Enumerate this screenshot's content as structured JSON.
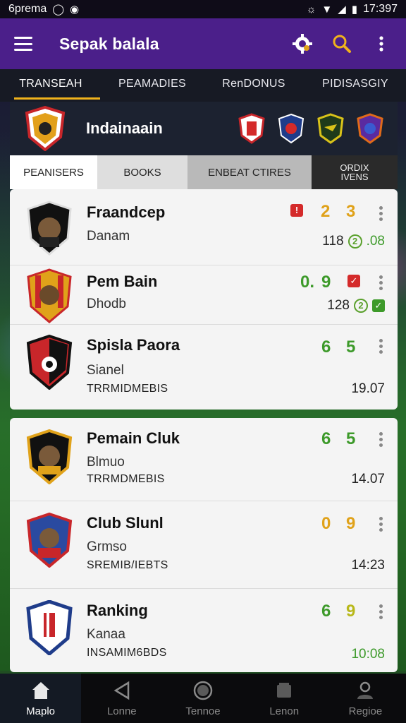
{
  "status_bar": {
    "carrier": "6prema",
    "time": "17:397"
  },
  "app_bar": {
    "title": "Sepak balala"
  },
  "tabs": [
    {
      "label": "TRANSEAH",
      "active": true
    },
    {
      "label": "PEAMADIES",
      "active": false
    },
    {
      "label": "RenDONUS",
      "active": false
    },
    {
      "label": "PIDISASGIY",
      "active": false
    }
  ],
  "league": {
    "name": "Indainaain"
  },
  "filters": [
    {
      "label": "PEANISERS"
    },
    {
      "label": "BOOKS"
    },
    {
      "label": "ENBEAT CTIRES"
    },
    {
      "label_line1": "ORDIX",
      "label_line2": "IVENS"
    }
  ],
  "cards": {
    "first": [
      {
        "name": "Fraandcep",
        "sub": "Danam",
        "sub2": "",
        "score1": "2",
        "score2": "3",
        "meta_value": "118",
        "meta_extra": ".08",
        "chip": "!"
      },
      {
        "name": "Pem Bain",
        "sub": "Dhodb",
        "sub2": "",
        "score1": "0.",
        "score2": "9",
        "meta_value": "128",
        "meta_extra": "",
        "chip": ""
      },
      {
        "name": "Spisla Paora",
        "sub": "Sianel",
        "sub2": "TRRMIDMEBIS",
        "score1": "6",
        "score2": "5",
        "meta_value": "19.07",
        "meta_extra": "",
        "chip": ""
      }
    ],
    "second": [
      {
        "name": "Pemain Cluk",
        "sub": "Blmuo",
        "sub2": "TRRMDMEBIS",
        "score1": "6",
        "score2": "5",
        "meta_value": "14.07"
      },
      {
        "name": "Club Slunl",
        "sub": "Grmso",
        "sub2": "SREMIB/IEBTS",
        "score1": "0",
        "score2": "9",
        "meta_value": "14:23"
      },
      {
        "name": "Ranking",
        "sub": "Kanaa",
        "sub2": "INSAMIM6BDS",
        "score1": "6",
        "score2": "9",
        "meta_value": "10:08"
      }
    ]
  },
  "bottom_nav": [
    {
      "label": "Maplo",
      "active": true
    },
    {
      "label": "Lonne",
      "active": false
    },
    {
      "label": "Tennoe",
      "active": false
    },
    {
      "label": "Lenon",
      "active": false
    },
    {
      "label": "Regioe",
      "active": false
    }
  ],
  "colors": {
    "app_bar": "#4b1f8a",
    "accent": "#f0b21c",
    "green": "#3d9a2a",
    "orange": "#e0a21a",
    "red": "#d42a2a"
  }
}
